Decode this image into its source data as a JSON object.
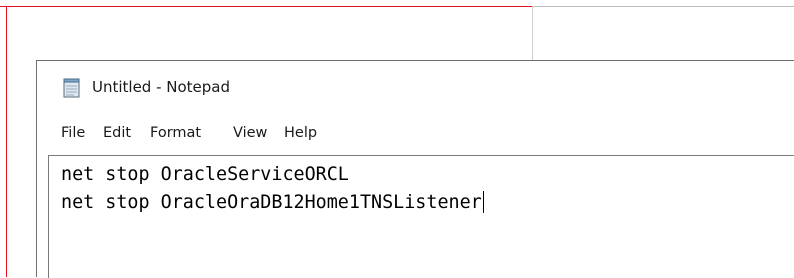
{
  "window": {
    "title": "Untitled - Notepad",
    "app_icon": "notepad-icon"
  },
  "menu": {
    "items": [
      {
        "label": "File"
      },
      {
        "label": "Edit"
      },
      {
        "label": "Format"
      },
      {
        "label": "View"
      },
      {
        "label": "Help"
      }
    ]
  },
  "editor": {
    "lines": [
      "net stop OracleServiceORCL",
      "net stop OracleOraDB12Home1TNSListener"
    ]
  },
  "colors": {
    "background_window_border": "#e81123",
    "notepad_border": "#6f6f6f",
    "text": "#000000"
  }
}
